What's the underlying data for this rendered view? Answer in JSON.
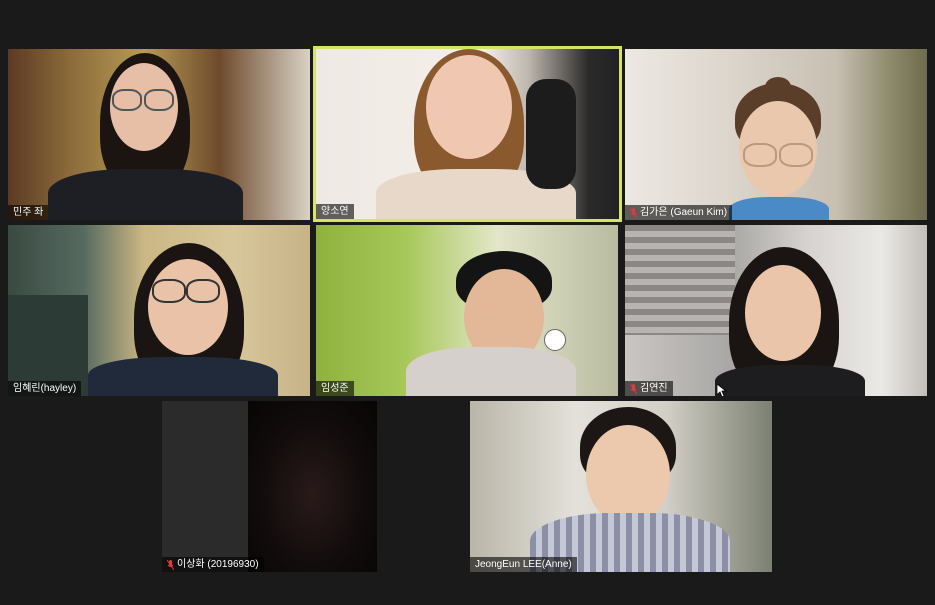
{
  "participants": [
    {
      "name": "민주 좌",
      "muted": false
    },
    {
      "name": "양소연",
      "muted": false,
      "active_speaker": true
    },
    {
      "name": "김가은 (Gaeun Kim)",
      "muted": true
    },
    {
      "name": "임혜린(hayley)",
      "muted": false
    },
    {
      "name": "임성준",
      "muted": false
    },
    {
      "name": "김연진",
      "muted": true
    },
    {
      "name": "이상화 (20196930)",
      "muted": true
    },
    {
      "name": "JeongEun LEE(Anne)",
      "muted": false
    }
  ],
  "colors": {
    "active_border": "#d6e36a",
    "muted_icon": "#e0393e",
    "background": "#1a1a1a"
  }
}
